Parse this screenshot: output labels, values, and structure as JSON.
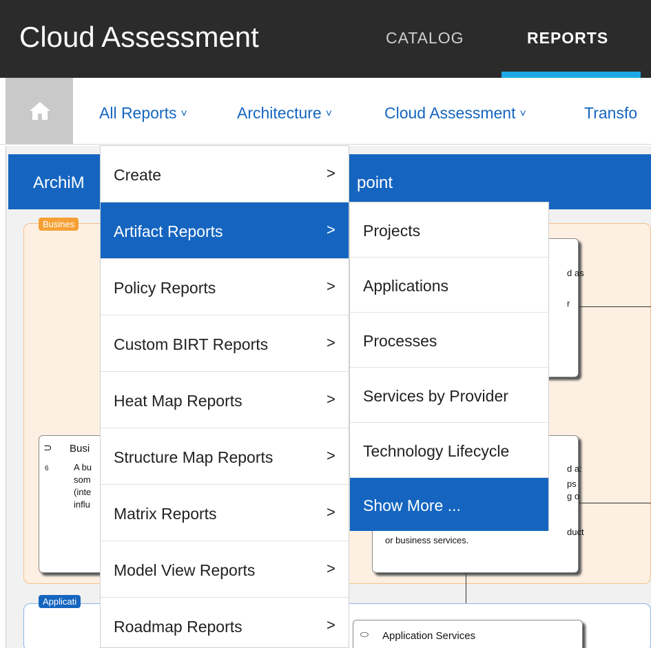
{
  "header": {
    "app_title": "Cloud Assessment",
    "nav": [
      {
        "label": "CATALOG",
        "active": false
      },
      {
        "label": "REPORTS",
        "active": true
      }
    ]
  },
  "subnav": {
    "home_icon": "home-icon",
    "items": [
      {
        "label": "All Reports"
      },
      {
        "label": "Architecture"
      },
      {
        "label": "Cloud Assessment"
      },
      {
        "label": "Transfo"
      }
    ],
    "chevron": "❯"
  },
  "background": {
    "view_title_left": "ArchiM",
    "view_title_right": "point",
    "business_tag": "Busines",
    "application_tag": "Applicati",
    "box1_lines": [
      "d as",
      "r"
    ],
    "box2_lines": [
      "Busi",
      "A bu",
      "som",
      "(inte",
      "influ",
      "6"
    ],
    "box3_lines": [
      "d a:",
      "ps",
      "g o",
      "duct",
      "or business services."
    ],
    "box4_label": "Application Services"
  },
  "menu_all_reports": {
    "items": [
      {
        "label": "Create",
        "has_submenu": true,
        "active": false
      },
      {
        "label": "Artifact Reports",
        "has_submenu": true,
        "active": true
      },
      {
        "label": "Policy Reports",
        "has_submenu": true,
        "active": false
      },
      {
        "label": "Custom BIRT Reports",
        "has_submenu": true,
        "active": false
      },
      {
        "label": "Heat Map Reports",
        "has_submenu": true,
        "active": false
      },
      {
        "label": "Structure Map Reports",
        "has_submenu": true,
        "active": false
      },
      {
        "label": "Matrix Reports",
        "has_submenu": true,
        "active": false
      },
      {
        "label": "Model View Reports",
        "has_submenu": true,
        "active": false
      },
      {
        "label": "Roadmap Reports",
        "has_submenu": true,
        "active": false
      }
    ],
    "arrow": ">"
  },
  "menu_artifact_reports": {
    "items": [
      {
        "label": "Projects",
        "active": false
      },
      {
        "label": "Applications",
        "active": false
      },
      {
        "label": "Processes",
        "active": false
      },
      {
        "label": "Services by Provider",
        "active": false
      },
      {
        "label": "Technology Lifecycle",
        "active": false
      },
      {
        "label": "Show More ...",
        "active": true
      }
    ]
  },
  "colors": {
    "header_bg": "#2b2b2b",
    "accent_blue": "#1565c0",
    "underline": "#1ea9e6",
    "business_orange": "#f5a035"
  }
}
